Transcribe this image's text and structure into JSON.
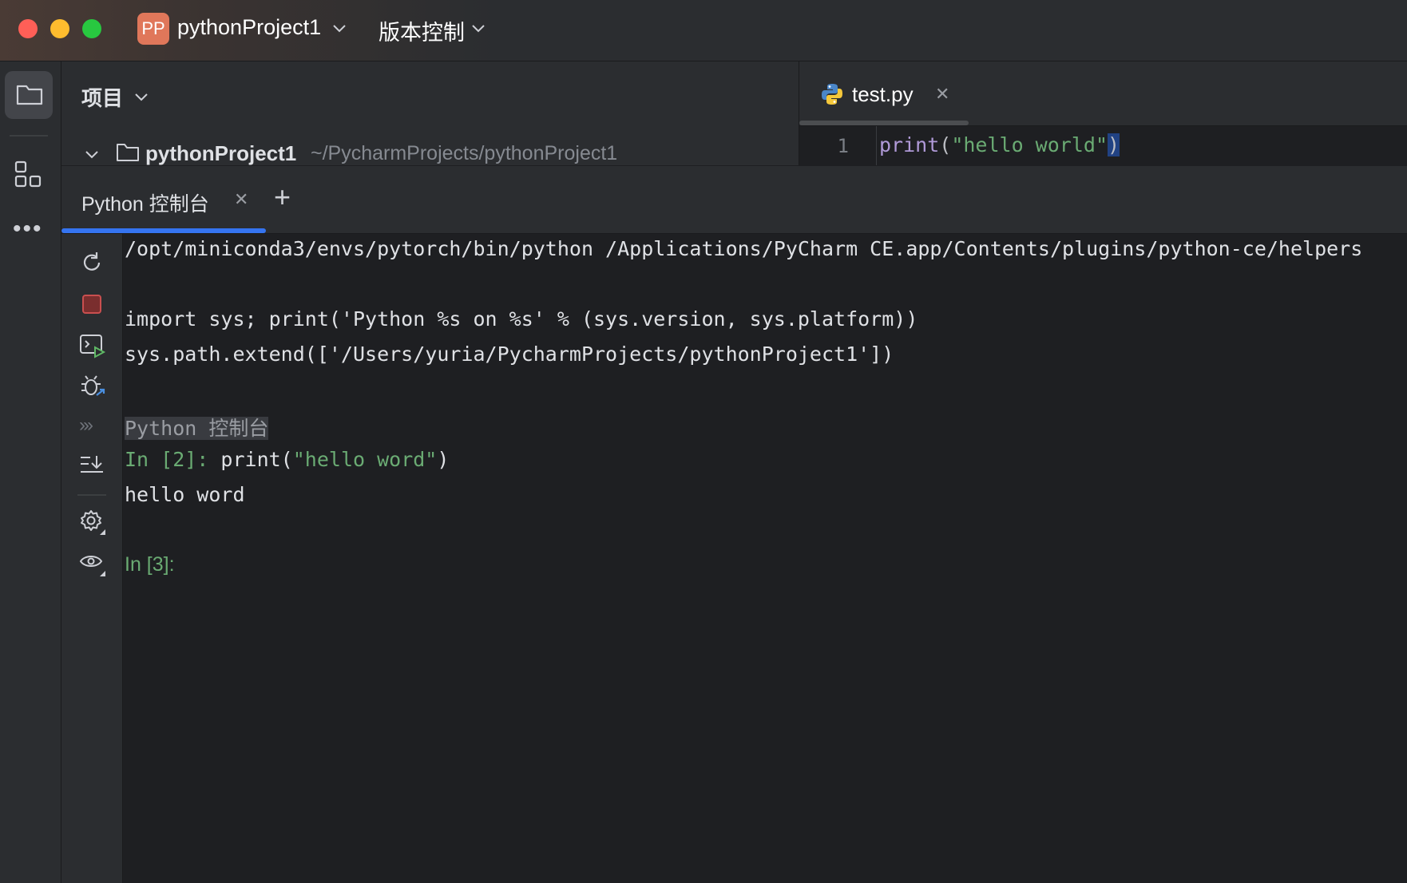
{
  "titlebar": {
    "project_badge": "PP",
    "project_name": "pythonProject1",
    "vcs_label": "版本控制"
  },
  "project_panel": {
    "title": "项目",
    "root_name": "pythonProject1",
    "root_path": "~/PycharmProjects/pythonProject1"
  },
  "editor": {
    "tab_label": "test.py",
    "line_number": "1",
    "code": {
      "fn": "print",
      "open": "(",
      "string": "\"hello world\"",
      "close": ")"
    }
  },
  "console": {
    "tab_label": "Python 控制台",
    "lines": {
      "command": "/opt/miniconda3/envs/pytorch/bin/python /Applications/PyCharm CE.app/Contents/plugins/python-ce/helpers",
      "import_line": "import sys; print('Python %s on %s' % (sys.version, sys.platform))",
      "path_line": "sys.path.extend(['/Users/yuria/PycharmProjects/pythonProject1'])",
      "console_name": "Python 控制台",
      "prompt2": "In [2]: ",
      "input_fn": "print(",
      "input_str": "\"hello word\"",
      "input_close": ")",
      "output": "hello word",
      "prompt3": "In [3]:"
    }
  },
  "colors": {
    "accent": "#3574f0",
    "prompt_green": "#6aab73",
    "stop_red": "#c94f4f"
  }
}
